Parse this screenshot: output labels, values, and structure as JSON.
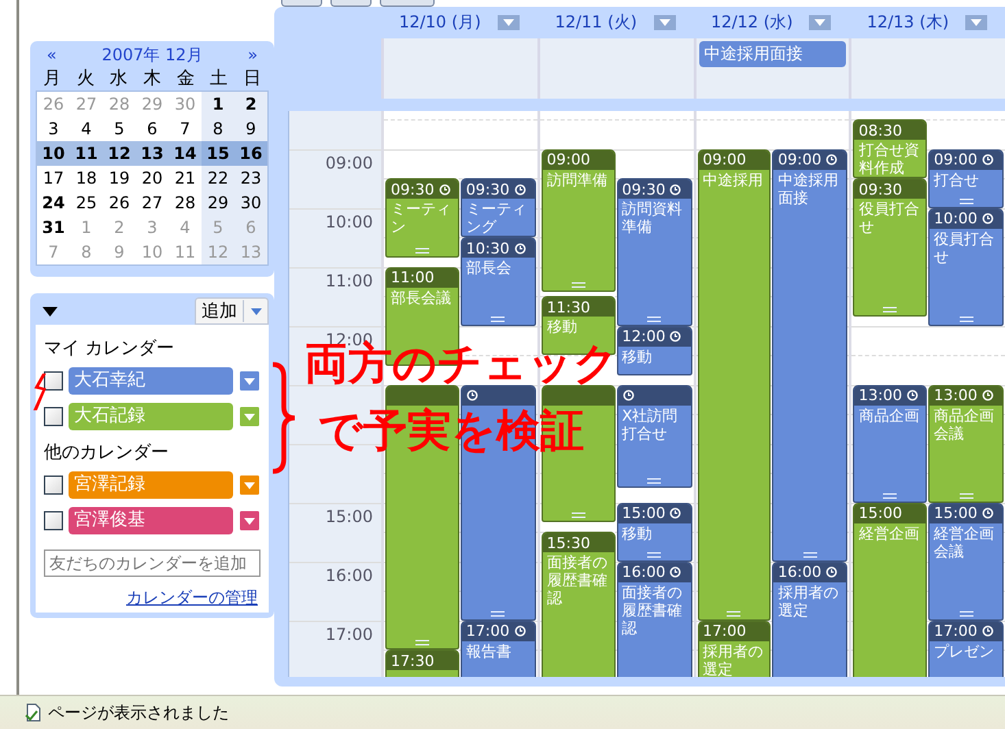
{
  "mini_calendar": {
    "prev": "«",
    "title": "2007年 12月",
    "next": "»",
    "weekdays": [
      "月",
      "火",
      "水",
      "木",
      "金",
      "土",
      "日"
    ],
    "days": [
      {
        "d": "26",
        "other": true,
        "bold": false,
        "selected": false
      },
      {
        "d": "27",
        "other": true,
        "bold": false,
        "selected": false
      },
      {
        "d": "28",
        "other": true,
        "bold": false,
        "selected": false
      },
      {
        "d": "29",
        "other": true,
        "bold": false,
        "selected": false
      },
      {
        "d": "30",
        "other": true,
        "bold": false,
        "selected": false
      },
      {
        "d": "1",
        "other": false,
        "bold": true,
        "selected": false
      },
      {
        "d": "2",
        "other": false,
        "bold": true,
        "selected": false
      },
      {
        "d": "3",
        "other": false,
        "bold": false,
        "selected": false
      },
      {
        "d": "4",
        "other": false,
        "bold": false,
        "selected": false
      },
      {
        "d": "5",
        "other": false,
        "bold": false,
        "selected": false
      },
      {
        "d": "6",
        "other": false,
        "bold": false,
        "selected": false
      },
      {
        "d": "7",
        "other": false,
        "bold": false,
        "selected": false
      },
      {
        "d": "8",
        "other": false,
        "bold": false,
        "selected": false
      },
      {
        "d": "9",
        "other": false,
        "bold": false,
        "selected": false
      },
      {
        "d": "10",
        "other": false,
        "bold": true,
        "selected": true
      },
      {
        "d": "11",
        "other": false,
        "bold": true,
        "selected": true
      },
      {
        "d": "12",
        "other": false,
        "bold": true,
        "selected": true
      },
      {
        "d": "13",
        "other": false,
        "bold": true,
        "selected": true
      },
      {
        "d": "14",
        "other": false,
        "bold": true,
        "selected": true
      },
      {
        "d": "15",
        "other": false,
        "bold": true,
        "selected": true
      },
      {
        "d": "16",
        "other": false,
        "bold": true,
        "selected": true
      },
      {
        "d": "17",
        "other": false,
        "bold": false,
        "selected": false
      },
      {
        "d": "18",
        "other": false,
        "bold": false,
        "selected": false
      },
      {
        "d": "19",
        "other": false,
        "bold": false,
        "selected": false
      },
      {
        "d": "20",
        "other": false,
        "bold": false,
        "selected": false
      },
      {
        "d": "21",
        "other": false,
        "bold": false,
        "selected": false
      },
      {
        "d": "22",
        "other": false,
        "bold": false,
        "selected": false
      },
      {
        "d": "23",
        "other": false,
        "bold": false,
        "selected": false
      },
      {
        "d": "24",
        "other": false,
        "bold": true,
        "selected": false
      },
      {
        "d": "25",
        "other": false,
        "bold": false,
        "selected": false
      },
      {
        "d": "26",
        "other": false,
        "bold": false,
        "selected": false
      },
      {
        "d": "27",
        "other": false,
        "bold": false,
        "selected": false
      },
      {
        "d": "28",
        "other": false,
        "bold": false,
        "selected": false
      },
      {
        "d": "29",
        "other": false,
        "bold": false,
        "selected": false
      },
      {
        "d": "30",
        "other": false,
        "bold": false,
        "selected": false
      },
      {
        "d": "31",
        "other": false,
        "bold": true,
        "selected": false
      },
      {
        "d": "1",
        "other": true,
        "bold": false,
        "selected": false
      },
      {
        "d": "2",
        "other": true,
        "bold": false,
        "selected": false
      },
      {
        "d": "3",
        "other": true,
        "bold": false,
        "selected": false
      },
      {
        "d": "4",
        "other": true,
        "bold": false,
        "selected": false
      },
      {
        "d": "5",
        "other": true,
        "bold": false,
        "selected": false
      },
      {
        "d": "6",
        "other": true,
        "bold": false,
        "selected": false
      },
      {
        "d": "7",
        "other": true,
        "bold": false,
        "selected": false
      },
      {
        "d": "8",
        "other": true,
        "bold": false,
        "selected": false
      },
      {
        "d": "9",
        "other": true,
        "bold": false,
        "selected": false
      },
      {
        "d": "10",
        "other": true,
        "bold": false,
        "selected": false
      },
      {
        "d": "11",
        "other": true,
        "bold": false,
        "selected": false
      },
      {
        "d": "12",
        "other": true,
        "bold": false,
        "selected": false
      },
      {
        "d": "13",
        "other": true,
        "bold": false,
        "selected": false
      }
    ]
  },
  "calendar_list": {
    "add_button": "追加",
    "groups": [
      {
        "title": "マイ カレンダー",
        "items": [
          {
            "name": "大石幸紀",
            "color": "#668cd9",
            "checked": false
          },
          {
            "name": "大石記録",
            "color": "#8cbf40",
            "checked": false
          }
        ]
      },
      {
        "title": "他のカレンダー",
        "items": [
          {
            "name": "宮澤記録",
            "color": "#f08c00",
            "checked": false
          },
          {
            "name": "宮澤俊基",
            "color": "#dc4777",
            "checked": false
          }
        ]
      }
    ],
    "search": {
      "placeholder": "友だちのカレンダーを追加"
    },
    "manage_link": "カレンダーの管理"
  },
  "week_view": {
    "hours": [
      "09:00",
      "10:00",
      "11:00",
      "12:00",
      "15:00",
      "16:00",
      "17:00"
    ],
    "days": [
      {
        "label": "12/10 (月)",
        "events": [
          {
            "time": "09:30",
            "alarm": true,
            "title": "ミーティン",
            "color": "#8cbf40"
          },
          {
            "time": "09:30",
            "alarm": true,
            "title": "ミーティング",
            "color": "#668cd9"
          },
          {
            "time": "10:30",
            "alarm": true,
            "title": "部長会",
            "color": "#668cd9"
          },
          {
            "time": "11:00",
            "alarm": false,
            "title": "部長会議",
            "color": "#8cbf40"
          },
          {
            "alarm": false,
            "color": "#8cbf40"
          },
          {
            "alarm": true,
            "color": "#668cd9"
          },
          {
            "time": "17:00",
            "alarm": true,
            "title": "報告書",
            "color": "#668cd9"
          },
          {
            "time": "17:30",
            "alarm": false,
            "color": "#8cbf40"
          }
        ]
      },
      {
        "label": "12/11 (火)",
        "events": [
          {
            "time": "09:00",
            "alarm": false,
            "title": "訪問準備",
            "color": "#8cbf40"
          },
          {
            "time": "09:30",
            "alarm": true,
            "title": "訪問資料準備",
            "color": "#668cd9"
          },
          {
            "time": "11:30",
            "alarm": false,
            "title": "移動",
            "color": "#8cbf40"
          },
          {
            "time": "12:00",
            "alarm": true,
            "title": "移動",
            "color": "#668cd9"
          },
          {
            "alarm": false,
            "color": "#8cbf40"
          },
          {
            "alarm": true,
            "title": "X社訪問打合せ",
            "color": "#668cd9"
          },
          {
            "time": "15:00",
            "alarm": true,
            "title": "移動",
            "color": "#668cd9"
          },
          {
            "time": "15:30",
            "alarm": false,
            "title": "面接者の履歴書確認",
            "color": "#8cbf40"
          },
          {
            "time": "16:00",
            "alarm": true,
            "title": "面接者の履歴書確認",
            "color": "#668cd9"
          }
        ]
      },
      {
        "label": "12/12 (水)",
        "allday": [
          {
            "title": "中途採用面接",
            "color": "#668cd9"
          }
        ],
        "events": [
          {
            "time": "09:00",
            "alarm": false,
            "title": "中途採用",
            "color": "#8cbf40"
          },
          {
            "time": "09:00",
            "alarm": true,
            "title": "中途採用面接",
            "color": "#668cd9"
          },
          {
            "time": "16:00",
            "alarm": true,
            "title": "採用者の選定",
            "color": "#668cd9"
          },
          {
            "time": "17:00",
            "alarm": false,
            "title": "採用者の選定",
            "color": "#8cbf40"
          }
        ]
      },
      {
        "label": "12/13 (木)",
        "events": [
          {
            "time": "08:30",
            "alarm": false,
            "title": "打合せ資料作成",
            "color": "#8cbf40"
          },
          {
            "time": "09:00",
            "alarm": true,
            "title": "打合せ",
            "color": "#668cd9"
          },
          {
            "time": "09:30",
            "alarm": false,
            "title": "役員打合せ",
            "color": "#8cbf40"
          },
          {
            "time": "10:00",
            "alarm": true,
            "title": "役員打合せ",
            "color": "#668cd9"
          },
          {
            "time": "13:00",
            "alarm": true,
            "title": "商品企画",
            "color": "#668cd9"
          },
          {
            "time": "13:00",
            "alarm": true,
            "title": "商品企画会議",
            "color": "#8cbf40"
          },
          {
            "time": "15:00",
            "alarm": false,
            "title": "経営企画",
            "color": "#8cbf40"
          },
          {
            "time": "15:00",
            "alarm": true,
            "title": "経営企画会議",
            "color": "#668cd9"
          },
          {
            "time": "17:00",
            "alarm": true,
            "title": "プレゼン",
            "color": "#668cd9"
          }
        ]
      }
    ]
  },
  "annotation": {
    "lines": [
      "両方のチェック",
      "で予実を検証"
    ]
  },
  "status_bar": {
    "text": "ページが表示されました"
  }
}
